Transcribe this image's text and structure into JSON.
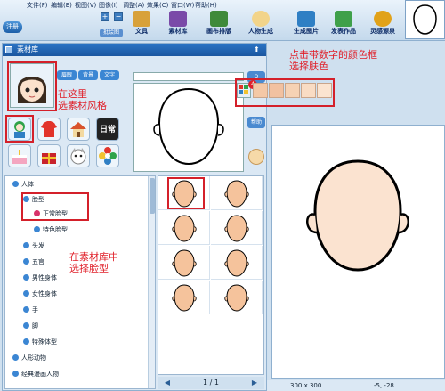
{
  "toolbar": {
    "app_button": "注册",
    "menu": [
      "文件(F)",
      "编辑(E)",
      "视图(V)",
      "图像(I)",
      "调整(A)",
      "效果(C)",
      "窗口(W)",
      "帮助(H)"
    ],
    "tag_button": "批绘图",
    "items": [
      {
        "label": "文具",
        "icon": "stationery-icon",
        "color": "#d8a13a"
      },
      {
        "label": "素材库",
        "icon": "library-icon",
        "color": "#7a4aa8"
      },
      {
        "label": "画布排版",
        "icon": "canvas-layout-icon",
        "color": "#3f8a3a"
      },
      {
        "label": "人物生成",
        "icon": "eye-icon",
        "color": "#c38a2a"
      },
      {
        "label": "生成图片",
        "icon": "generate-image-icon",
        "color": "#2f7fc4"
      },
      {
        "label": "发表作品",
        "icon": "publish-icon",
        "color": "#3fa04a"
      },
      {
        "label": "灵感源泉",
        "icon": "lightbulb-icon",
        "color": "#e1a21a"
      }
    ]
  },
  "panel": {
    "title": "素材库",
    "tabs": [
      "眉眼",
      "背景",
      "文字"
    ],
    "search_button": "Q",
    "help_button": "帮助",
    "daily_label": "日常",
    "note_style": "在这里\n选素材风格",
    "note_color": "点击带数字的颜色框\n选择肤色",
    "note_face": "在素材库中\n选择脸型",
    "swatch_badge": "4",
    "skin_colors": [
      "#f4c8a6",
      "#f2c1a0",
      "#f6d2b4",
      "#f9dcc4",
      "#fbe4d0"
    ],
    "categories": [
      "person-category-icon",
      "clothes-category-icon",
      "house-category-icon",
      "cake-category-icon",
      "gift-category-icon",
      "animal-category-icon",
      "flower-category-icon"
    ]
  },
  "tree": {
    "items": [
      {
        "label": "人体",
        "level": 0
      },
      {
        "label": "脸型",
        "level": 1
      },
      {
        "label": "正常脸型",
        "level": 2,
        "selected": true
      },
      {
        "label": "特色脸型",
        "level": 2
      },
      {
        "label": "头发",
        "level": 1
      },
      {
        "label": "五官",
        "level": 1
      },
      {
        "label": "男性身体",
        "level": 1
      },
      {
        "label": "女性身体",
        "level": 1
      },
      {
        "label": "手",
        "level": 1
      },
      {
        "label": "脚",
        "level": 1
      },
      {
        "label": "特殊体型",
        "level": 1
      },
      {
        "label": "人形动物",
        "level": 0
      },
      {
        "label": "经典漫画人物",
        "level": 0
      }
    ]
  },
  "grid": {
    "page": "1 / 1",
    "face_fill": "#f5c39c"
  },
  "status": {
    "size": "300 x 300",
    "coords": "-5, -28"
  }
}
